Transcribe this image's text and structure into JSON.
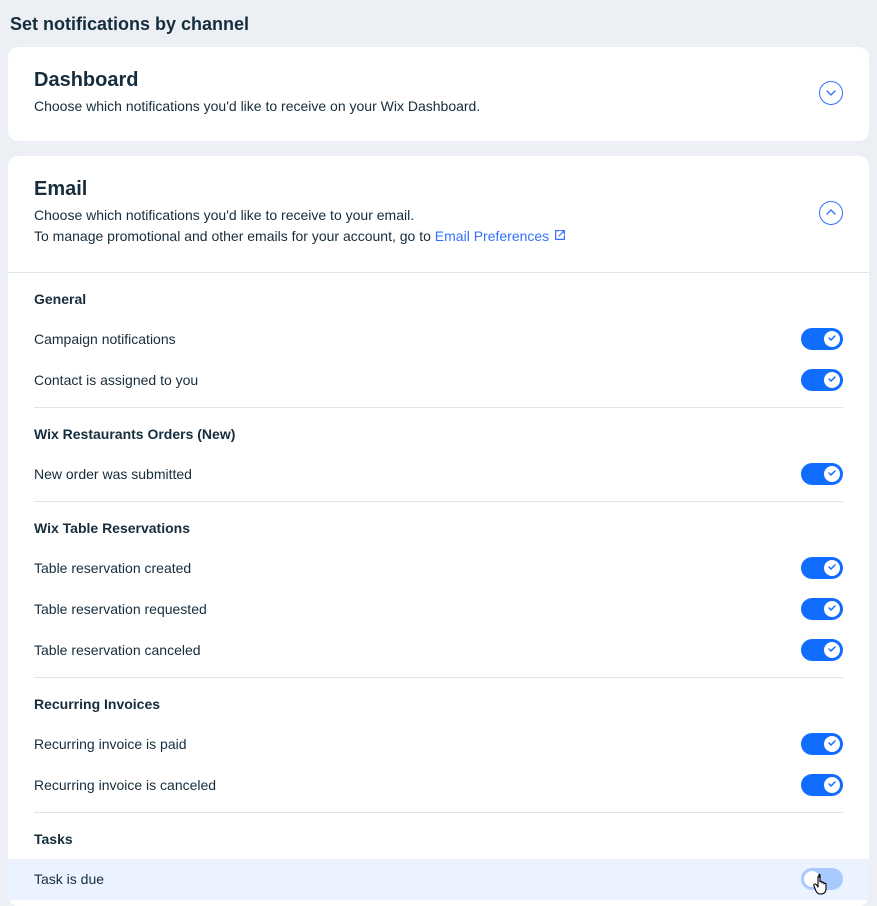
{
  "page_title": "Set notifications by channel",
  "dashboard": {
    "title": "Dashboard",
    "desc": "Choose which notifications you'd like to receive on your Wix Dashboard."
  },
  "email": {
    "title": "Email",
    "desc_line1": "Choose which notifications you'd like to receive to your email.",
    "desc_line2_prefix": "To manage promotional and other emails for your account, go to ",
    "desc_link": "Email Preferences",
    "groups": [
      {
        "title": "General",
        "items": [
          {
            "label": "Campaign notifications",
            "on": true
          },
          {
            "label": "Contact is assigned to you",
            "on": true
          }
        ]
      },
      {
        "title": "Wix Restaurants Orders (New)",
        "items": [
          {
            "label": "New order was submitted",
            "on": true
          }
        ]
      },
      {
        "title": "Wix Table Reservations",
        "items": [
          {
            "label": "Table reservation created",
            "on": true
          },
          {
            "label": "Table reservation requested",
            "on": true
          },
          {
            "label": "Table reservation canceled",
            "on": true
          }
        ]
      },
      {
        "title": "Recurring Invoices",
        "items": [
          {
            "label": "Recurring invoice is paid",
            "on": true
          },
          {
            "label": "Recurring invoice is canceled",
            "on": true
          }
        ]
      },
      {
        "title": "Tasks",
        "items": [
          {
            "label": "Task is due",
            "on": false,
            "hover": true
          }
        ]
      }
    ]
  }
}
